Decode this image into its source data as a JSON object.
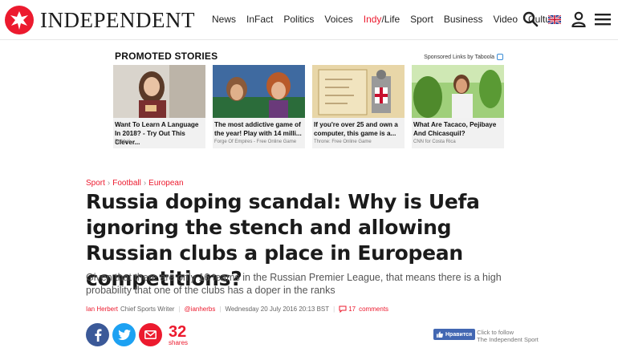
{
  "header": {
    "logo_text": "INDEPENDENT",
    "nav": [
      {
        "label": "News"
      },
      {
        "label": "InFact"
      },
      {
        "label": "Politics"
      },
      {
        "label": "Voices"
      },
      {
        "label": "Indy/Life"
      },
      {
        "label": "Sport"
      },
      {
        "label": "Business"
      },
      {
        "label": "Video"
      },
      {
        "label": "Culture"
      }
    ],
    "icons": [
      "search-icon",
      "uk-flag-icon",
      "user-icon",
      "menu-icon"
    ]
  },
  "promo": {
    "title": "PROMOTED STORIES",
    "sponsor": "Sponsored Links by Taboola",
    "items": [
      {
        "caption": "Want To Learn A Language In 2018? - Try Out This Clever...",
        "source": "Babbel"
      },
      {
        "caption": "The most addictive game of the year! Play with 14 milli...",
        "source": "Forge Of Empires - Free Online Game"
      },
      {
        "caption": "If you're over 25 and own a computer, this game is a...",
        "source": "Throne: Free Online Game"
      },
      {
        "caption": "What Are Tacaco, Pejibaye And Chicasquil?",
        "source": "CNN for Costa Rica"
      }
    ]
  },
  "article": {
    "breadcrumb": [
      "Sport",
      "Football",
      "European"
    ],
    "headline": "Russia doping scandal: Why is Uefa ignoring the stench and allowing Russian clubs a place in European competitions?",
    "standfirst": "Given that there are only 16 teams in the Russian Premier League, that means there is a high probability that one of the clubs has a doper in the ranks",
    "author": "Ian Herbert",
    "role": "Chief Sports Writer",
    "handle": "@ianherbs",
    "date": "Wednesday 20 July 2016 20:13 BST",
    "comments_count": "17",
    "comments_label": "comments",
    "share_count": "32",
    "share_label": "shares"
  },
  "follow": {
    "button": "Нравится",
    "line1": "Click to follow",
    "line2": "The Independent Sport"
  },
  "colors": {
    "brand_red": "#ec1a2e",
    "facebook": "#3b5998",
    "twitter": "#1da1f2"
  }
}
